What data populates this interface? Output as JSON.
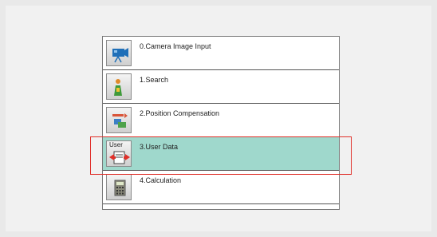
{
  "flow": {
    "items": [
      {
        "label": "0.Camera Image Input",
        "icon": "camera-icon",
        "selected": false
      },
      {
        "label": "1.Search",
        "icon": "search-icon",
        "selected": false
      },
      {
        "label": "2.Position Compensation",
        "icon": "position-compensation-icon",
        "selected": false
      },
      {
        "label": "3.User Data",
        "icon": "user-data-icon",
        "icon_text": "User",
        "selected": true
      },
      {
        "label": "4.Calculation",
        "icon": "calculator-icon",
        "selected": false
      }
    ]
  },
  "colors": {
    "selected_row": "#9fd8cc",
    "highlight_border": "#e0302a"
  }
}
